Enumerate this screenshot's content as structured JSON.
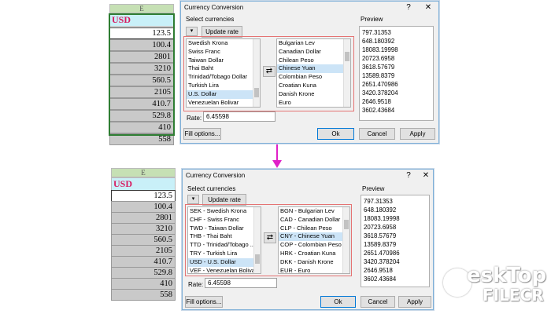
{
  "sheet": {
    "column": "E",
    "header": "USD",
    "values": [
      "123.5",
      "100.4",
      "2801",
      "3210",
      "560.5",
      "2105",
      "410.7",
      "529.8",
      "410",
      "558"
    ]
  },
  "dialog": {
    "title": "Currency Conversion",
    "help": "?",
    "close": "✕",
    "select_label": "Select currencies",
    "update_rate": "Update rate",
    "rate_label": "Rate:",
    "rate_value": "6.45598",
    "preview_label": "Preview",
    "preview_values": [
      "797.31353",
      "648.180392",
      "18083.19998",
      "20723.6958",
      "3618.57679",
      "13589.8379",
      "2651.470986",
      "3420.378204",
      "2646.9518",
      "3602.43684"
    ],
    "fill_options": "Fill options...",
    "ok": "Ok",
    "cancel": "Cancel",
    "apply": "Apply"
  },
  "top_lists": {
    "left": [
      "Swedish Krona",
      "Swiss Franc",
      "Taiwan Dollar",
      "Thai Baht",
      "Trinidad/Tobago Dollar",
      "Turkish Lira",
      "U.S. Dollar",
      "Venezuelan Bolivar"
    ],
    "right": [
      "Bulgarian Lev",
      "Canadian Dollar",
      "Chilean Peso",
      "Chinese Yuan",
      "Colombian Peso",
      "Croatian Kuna",
      "Danish Krone",
      "Euro"
    ]
  },
  "bottom_lists": {
    "left": [
      "SEK - Swedish Krona",
      "CHF - Swiss Franc",
      "TWD - Taiwan Dollar",
      "THB - Thai Baht",
      "TTD - Trinidad/Tobago ...",
      "TRY - Turkish Lira",
      "USD - U.S. Dollar",
      "VEF - Venezuelan Bolivar"
    ],
    "right": [
      "BGN - Bulgarian Lev",
      "CAD - Canadian Dollar",
      "CLP - Chilean Peso",
      "CNY - Chinese Yuan",
      "COP - Colombian Peso",
      "HRK - Croatian Kuna",
      "DKK - Danish Krone",
      "EUR - Euro"
    ]
  },
  "selected_index": 6,
  "target_index": 3,
  "colors": {
    "arrow": "#e020c8",
    "header_text": "#d81b60",
    "sheet_border": "#2e7d32",
    "selection": "#cce4f7"
  },
  "watermark": {
    "line1": "eskTop",
    "line2": "FILECR"
  }
}
